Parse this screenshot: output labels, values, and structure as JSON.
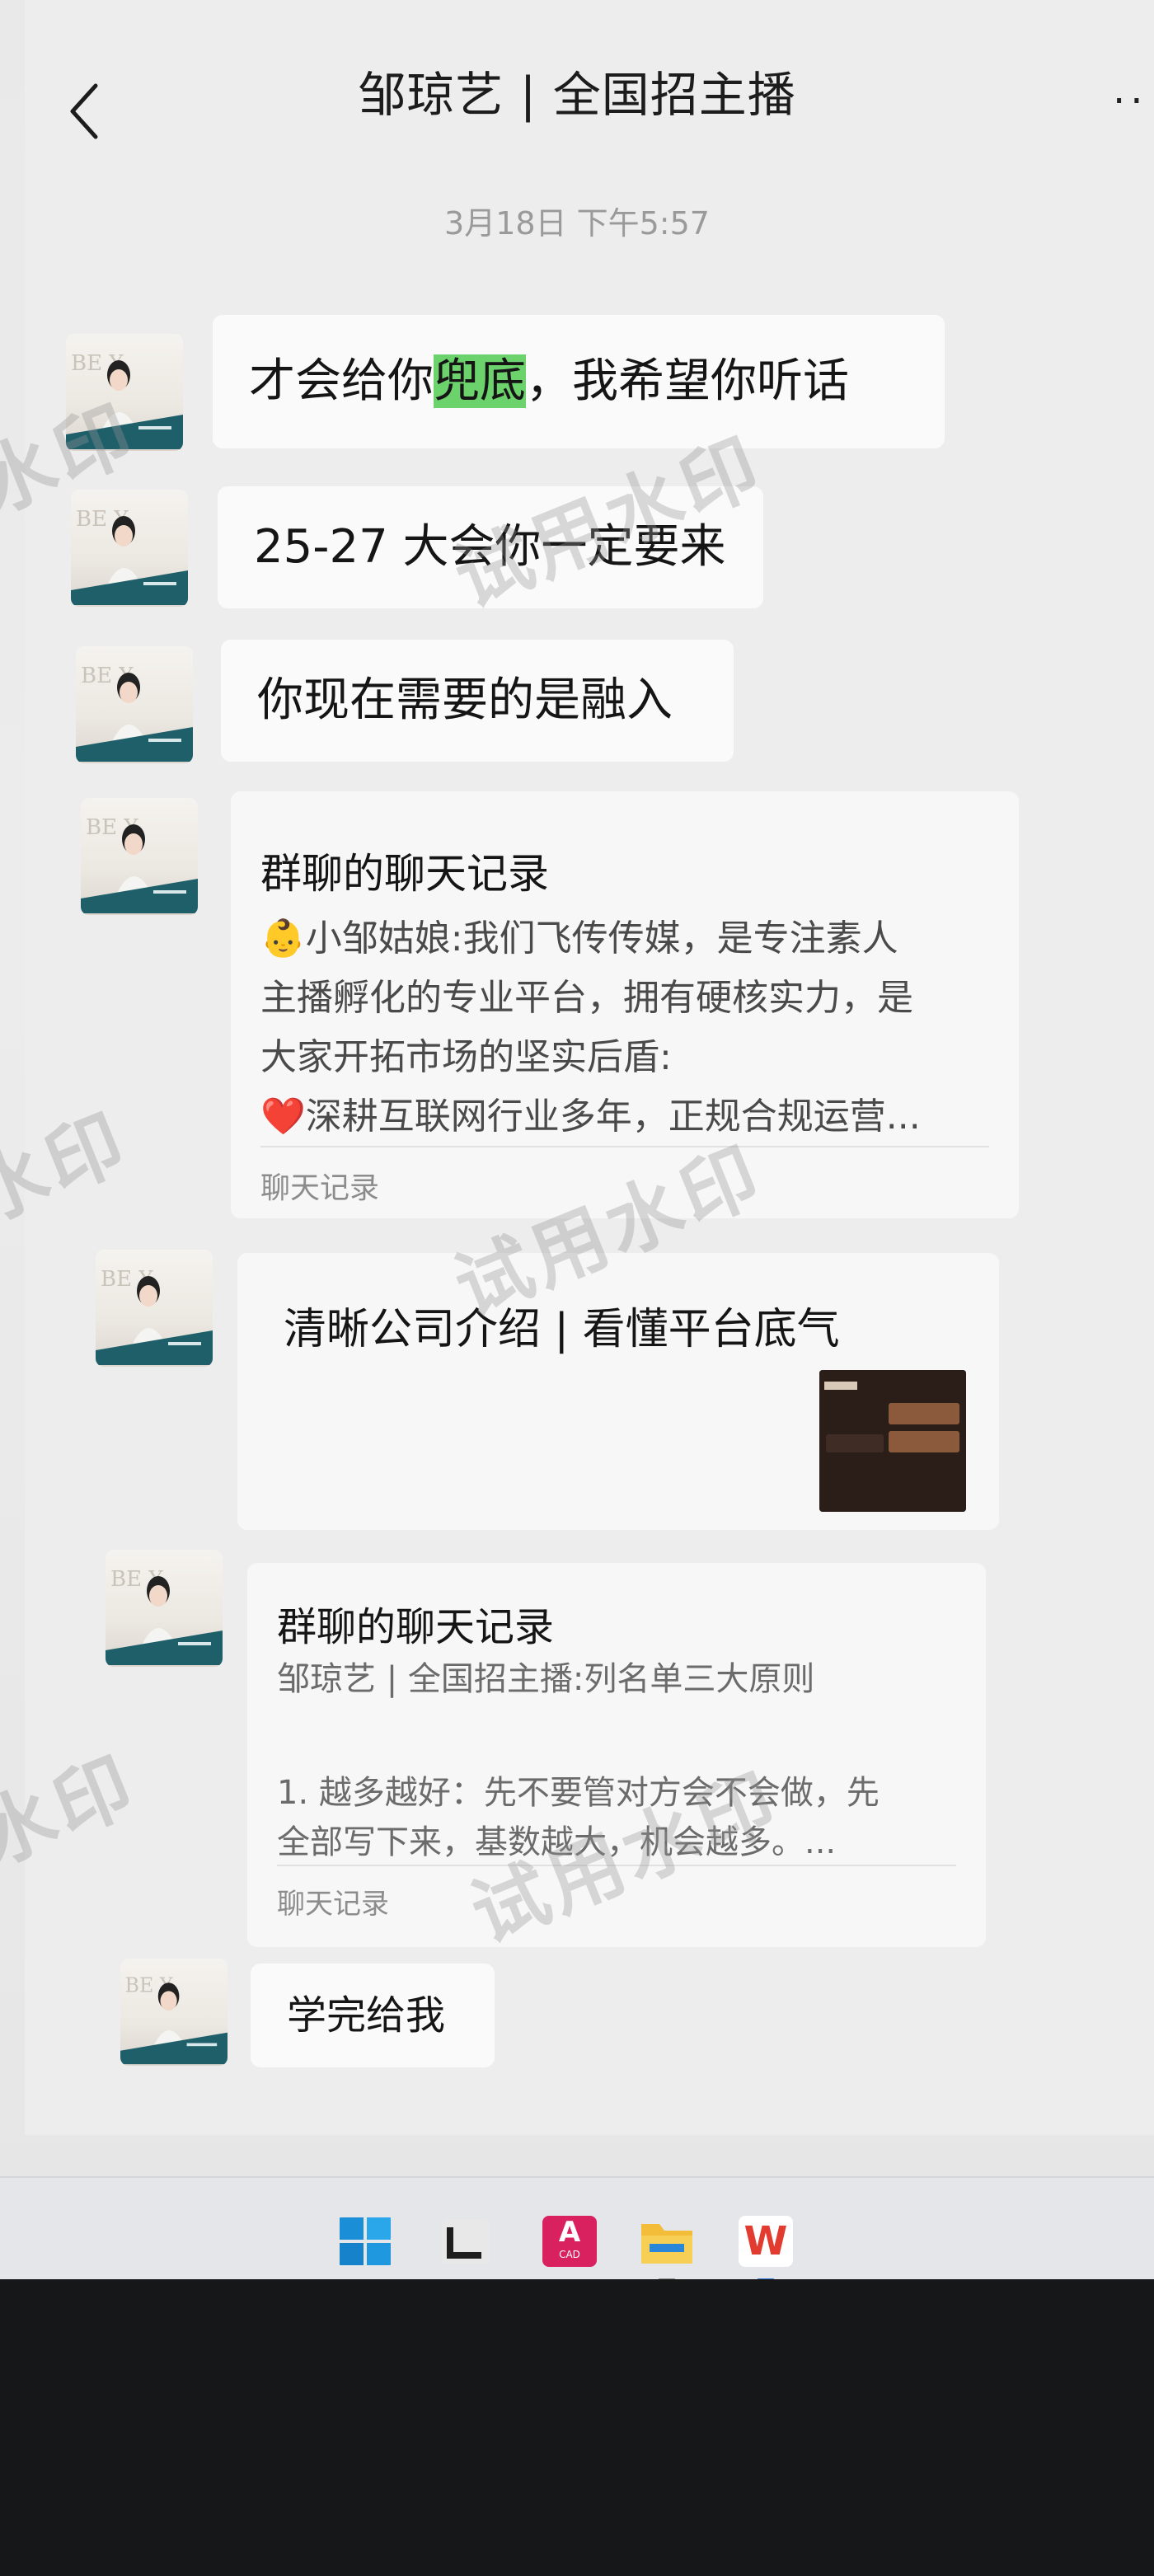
{
  "header": {
    "title": "邹琼艺 | 全国招主播",
    "back_icon": "chevron-left-icon",
    "more_icon": "more-dots-icon",
    "more_label": "··"
  },
  "timestamp": "3月18日 下午5:57",
  "messages": [
    {
      "type": "text",
      "pre": "才会给你",
      "highlight": "兜底",
      "post": "，我希望你听话"
    },
    {
      "type": "text",
      "text": "25-27 大会你一定要来"
    },
    {
      "type": "text",
      "text": "你现在需要的是融入"
    },
    {
      "type": "chat-record",
      "title": "群聊的聊天记录",
      "lines": [
        "👶小邹姑娘:我们飞传传媒，是专注素人",
        "主播孵化的专业平台，拥有硬核实力，是",
        "大家开拓市场的坚实后盾:",
        "深耕互联网行业多年，正规合规运营..."
      ],
      "heart": "❤️",
      "footer": "聊天记录"
    },
    {
      "type": "link",
      "title": "清晰公司介绍 | 看懂平台底气"
    },
    {
      "type": "chat-record",
      "title": "群聊的聊天记录",
      "lines": [
        "邹琼艺 | 全国招主播:列名单三大原则",
        "",
        "1. 越多越好：先不要管对方会不会做，先",
        "全部写下来，基数越大，机会越多。..."
      ],
      "footer": "聊天记录"
    },
    {
      "type": "text",
      "text": "学完给我"
    }
  ],
  "watermark": "试用水印",
  "taskbar": {
    "icons": [
      "windows-start-icon",
      "terminal-icon",
      "autocad-icon",
      "file-explorer-icon",
      "wps-office-icon"
    ],
    "autocad_label": "A",
    "autocad_sub": "CAD",
    "wps_label": "W"
  },
  "colors": {
    "chat_bg": "#ededed",
    "bubble": "#fafafa",
    "highlight": "#6cd26c",
    "timestamp": "#9a9a9a"
  }
}
